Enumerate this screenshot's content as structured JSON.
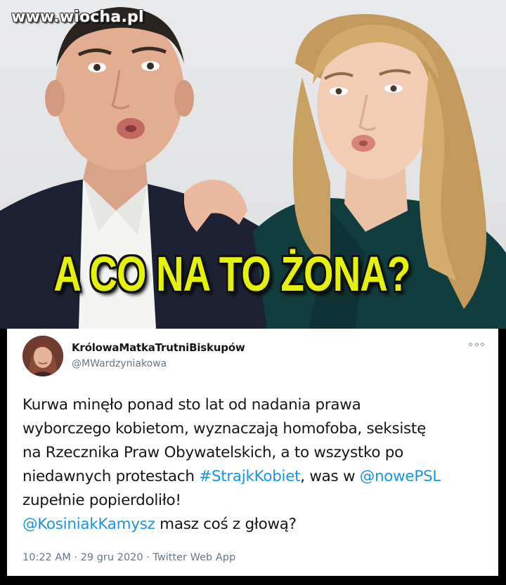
{
  "watermark": "www.wiocha.pl",
  "headline": "A CO NA TO ŻONA?",
  "tweet": {
    "display_name": "KrólowaMatkaTrutniBiskupów",
    "handle": "@MWardzyniakowa",
    "more_icon": "more-options-icon",
    "lines": {
      "l1": "Kurwa minęło ponad sto lat od nadania prawa",
      "l2": "wyborczego kobietom,  wyznaczają homofoba, seksistę",
      "l3": "na Rzecznika Praw Obywatelskich, a to wszystko po",
      "l4a": "niedawnych protestach ",
      "l4_hashtag": "#StrajkKobiet",
      "l4b": ", was w ",
      "l4_mention": "@nowePSL",
      "l5": "zupełnie popierdoliło!",
      "l6_mention": "@KosiniakKamysz",
      "l6b": " masz coś z głową?"
    },
    "time": "10:22 AM",
    "sep1": " · ",
    "date": "29 gru 2020",
    "sep2": " · ",
    "source": "Twitter Web App"
  },
  "colors": {
    "headline": "#e4f20a",
    "link": "#1b95e0",
    "meta": "#657786",
    "text": "#14171a"
  }
}
